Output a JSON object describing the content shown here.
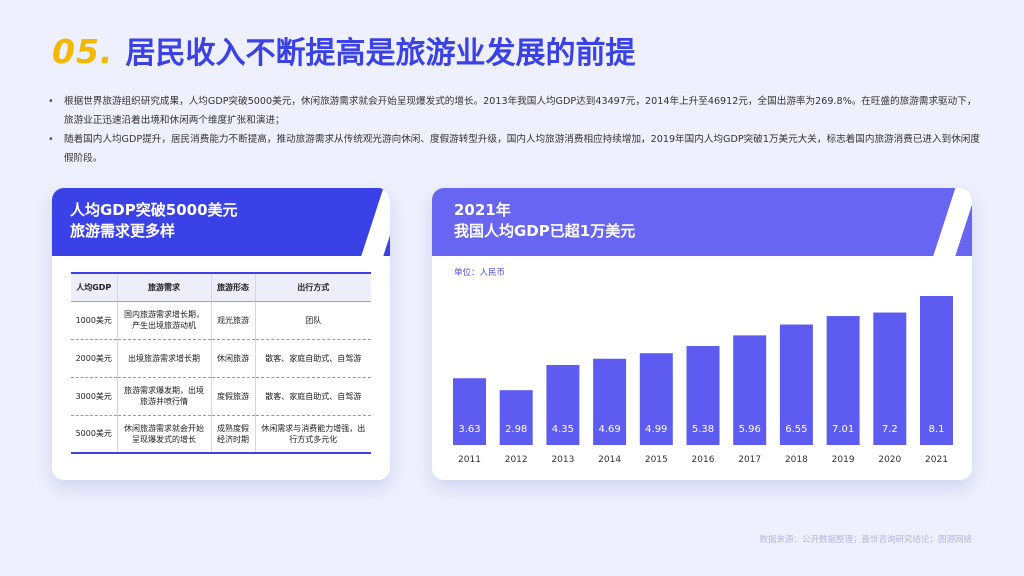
{
  "header": {
    "number": "05.",
    "title": "居民收入不断提高是旅游业发展的前提"
  },
  "bullets": [
    "根据世界旅游组织研究成果，人均GDP突破5000美元，休闲旅游需求就会开始呈现爆发式的增长。2013年我国人均GDP达到43497元，2014年上升至46912元，全国出游率为269.8%。在旺盛的旅游需求驱动下，旅游业正迅速沿着出境和休闲两个维度扩张和演进；",
    "随着国内人均GDP提升，居民消费能力不断提高，推动旅游需求从传统观光游向休闲、度假游转型升级，国内人均旅游消费相应持续增加，2019年国内人均GDP突破1万美元大关，标志着国内旅游消费已进入到休闲度假阶段。"
  ],
  "left_card": {
    "title_line1": "人均GDP突破5000美元",
    "title_line2": "旅游需求更多样",
    "table": {
      "headers": [
        "人均GDP",
        "旅游需求",
        "旅游形态",
        "出行方式"
      ],
      "rows": [
        [
          "1000美元",
          "国内旅游需求增长期，产生出境旅游动机",
          "观光旅游",
          "团队"
        ],
        [
          "2000美元",
          "出境旅游需求增长期",
          "休闲旅游",
          "散客、家庭自助式、自驾游"
        ],
        [
          "3000美元",
          "旅游需求爆发期，出境旅游井喷行情",
          "度假旅游",
          "散客、家庭自助式、自驾游"
        ],
        [
          "5000美元",
          "休闲旅游需求就会开始呈现爆发式的增长",
          "成熟度假经济时期",
          "休闲需求与消费能力增强，出行方式多元化"
        ]
      ]
    }
  },
  "right_card": {
    "title_line1": "2021年",
    "title_line2": "我国人均GDP已超1万美元"
  },
  "chart_data": {
    "type": "bar",
    "unit_label": "单位：人民币",
    "categories": [
      "2011",
      "2012",
      "2013",
      "2014",
      "2015",
      "2016",
      "2017",
      "2018",
      "2019",
      "2020",
      "2021"
    ],
    "values": [
      3.63,
      2.98,
      4.35,
      4.69,
      4.99,
      5.38,
      5.96,
      6.55,
      7.01,
      7.2,
      8.1
    ],
    "value_labels": [
      "3.63",
      "2.98",
      "4.35",
      "4.69",
      "4.99",
      "5.38",
      "5.96",
      "6.55",
      "7.01",
      "7.2",
      "8.1"
    ],
    "bar_color": "#5e5cf0",
    "label_color": "#ffffff",
    "ylim": [
      0,
      8.1
    ]
  },
  "footer": "数据来源：公开数据整理；嘉世咨询研究结论；图源网络"
}
